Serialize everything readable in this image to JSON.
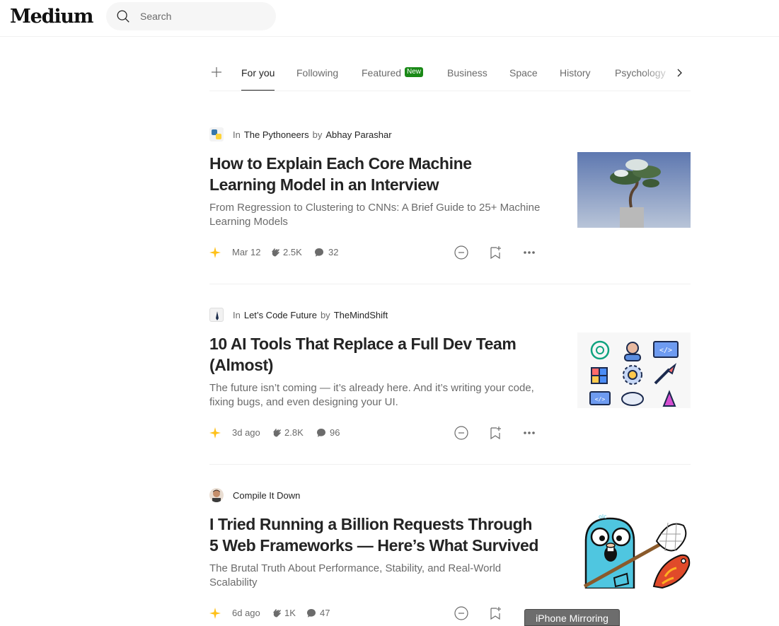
{
  "app": {
    "logo": "Medium"
  },
  "search": {
    "placeholder": "Search",
    "value": ""
  },
  "tabs": {
    "items": [
      {
        "label": "For you",
        "active": true
      },
      {
        "label": "Following"
      },
      {
        "label": "Featured",
        "badge": "New"
      },
      {
        "label": "Business"
      },
      {
        "label": "Space"
      },
      {
        "label": "History"
      },
      {
        "label": "Psychology"
      }
    ]
  },
  "articles": [
    {
      "in_label": "In",
      "publication": "The Pythoneers",
      "by_label": "by",
      "author": "Abhay Parashar",
      "title": "How to Explain Each Core Machine Learning Model in an Interview",
      "subtitle": "From Regression to Clustering to CNNs: A Brief Guide to 25+ Machine Learning Models",
      "date": "Mar 12",
      "claps": "2.5K",
      "responses": "32"
    },
    {
      "in_label": "In",
      "publication": "Let’s Code Future",
      "by_label": "by",
      "author": "TheMindShift",
      "title": "10 AI Tools That Replace a Full Dev Team (Almost)",
      "subtitle": "The future isn’t coming — it’s already here. And it’s writing your code, fixing bugs, and even designing your UI.",
      "date": "3d ago",
      "claps": "2.8K",
      "responses": "96"
    },
    {
      "author": "Compile It Down",
      "title": "I Tried Running a Billion Requests Through 5 Web Frameworks — Here’s What Survived",
      "subtitle": "The Brutal Truth About Performance, Stability, and Real-World Scalability",
      "date": "6d ago",
      "claps": "1K",
      "responses": "47"
    }
  ],
  "overlay": {
    "label": "iPhone Mirroring"
  },
  "colors": {
    "accent_green": "#1a8917",
    "member_star": "#ffc017",
    "text": "#242424",
    "muted": "#6b6b6b"
  },
  "icons": [
    "search-icon",
    "plus-icon",
    "chevron-right-icon",
    "member-star-icon",
    "clap-icon",
    "response-icon",
    "show-less-icon",
    "bookmark-add-icon",
    "more-icon"
  ]
}
